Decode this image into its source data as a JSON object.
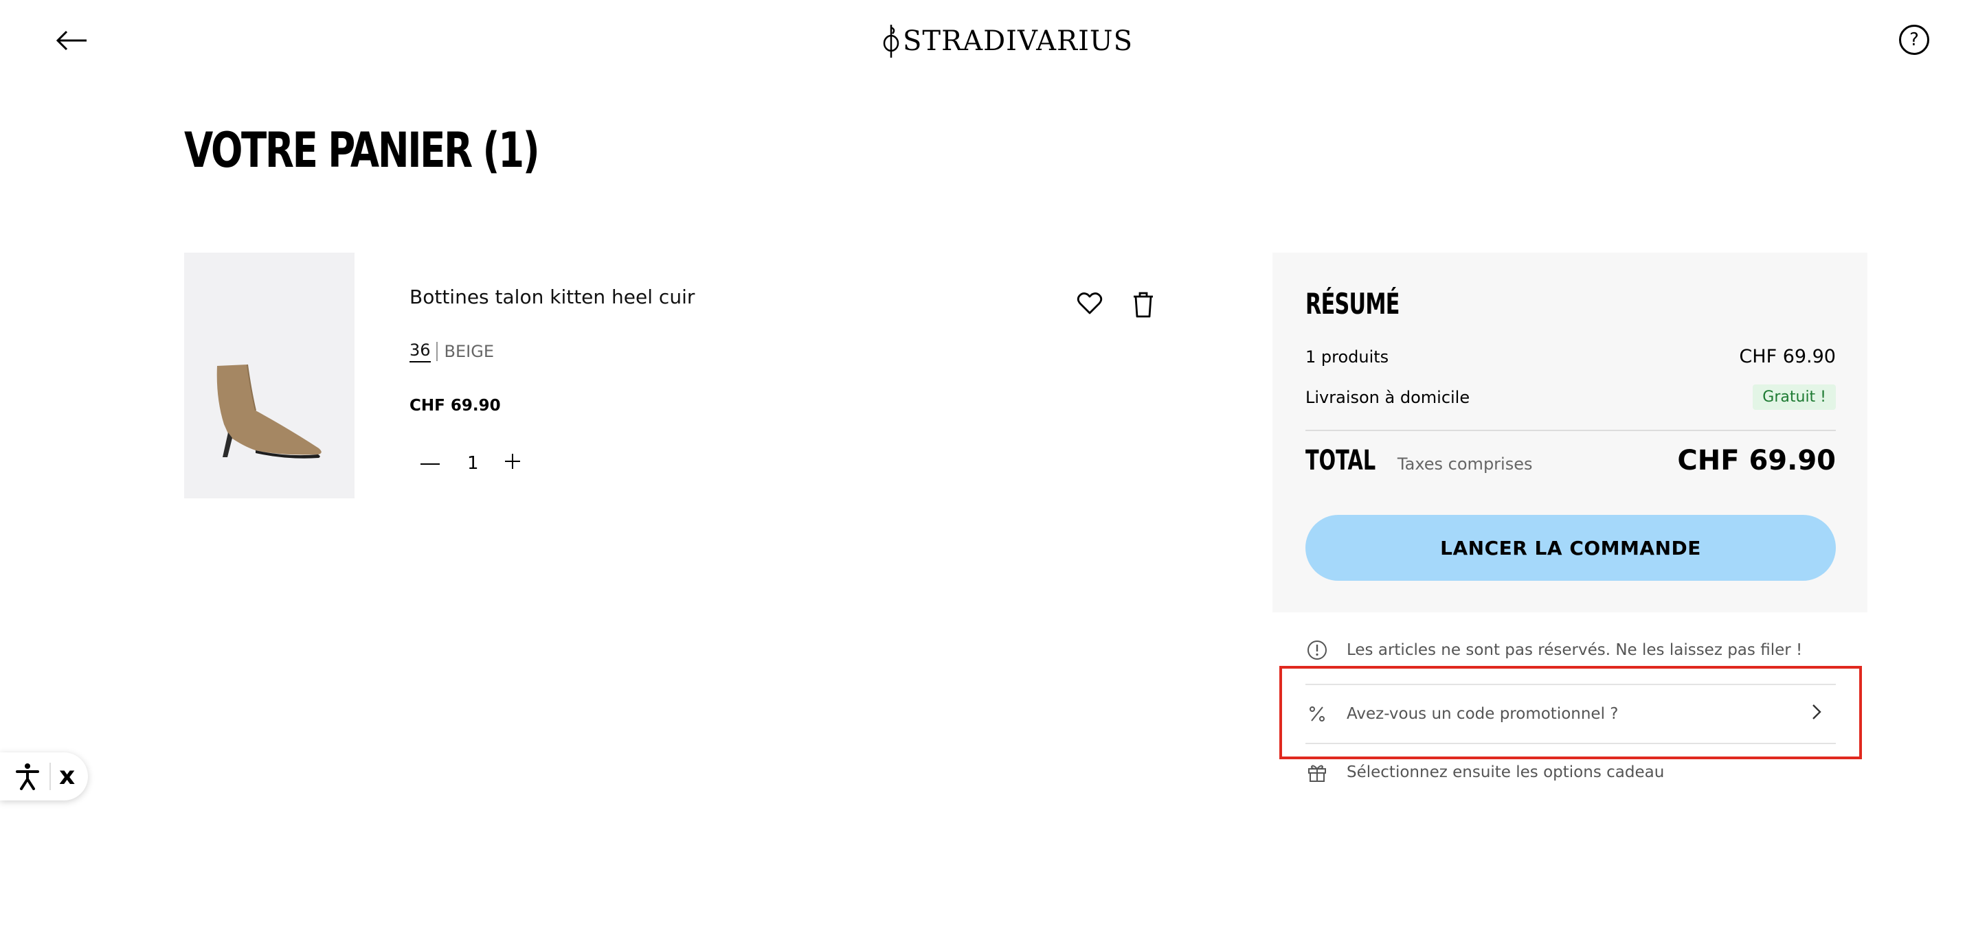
{
  "header": {
    "brand": "STRADIVARIUS",
    "back_icon": "arrow-left-icon",
    "help_icon": "question-circle-icon",
    "help_glyph": "?"
  },
  "cart": {
    "title": "VOTRE PANIER (1)",
    "items": [
      {
        "name": "Bottines talon kitten heel cuir",
        "size": "36",
        "color": "BEIGE",
        "price": "CHF 69.90",
        "quantity": "1"
      }
    ]
  },
  "summary": {
    "title": "RÉSUMÉ",
    "products_label": "1 produits",
    "products_amount": "CHF 69.90",
    "delivery_label": "Livraison à domicile",
    "delivery_badge": "Gratuit !",
    "total_label": "TOTAL",
    "taxes_label": "Taxes comprises",
    "total_amount": "CHF 69.90",
    "checkout_label": "LANCER LA COMMANDE"
  },
  "info": {
    "notice": "Les articles ne sont pas réservés. Ne les laissez pas filer !",
    "promo": "Avez-vous un code promotionnel ?",
    "gift": "Sélectionnez ensuite les options cadeau"
  },
  "accessibility": {
    "close_glyph": "x"
  },
  "colors": {
    "checkout_button": "#a5d8fa",
    "badge_bg": "#e3f5e6",
    "badge_text": "#1d7a32",
    "highlight": "#e0291f",
    "summary_bg": "#f7f7f7"
  }
}
